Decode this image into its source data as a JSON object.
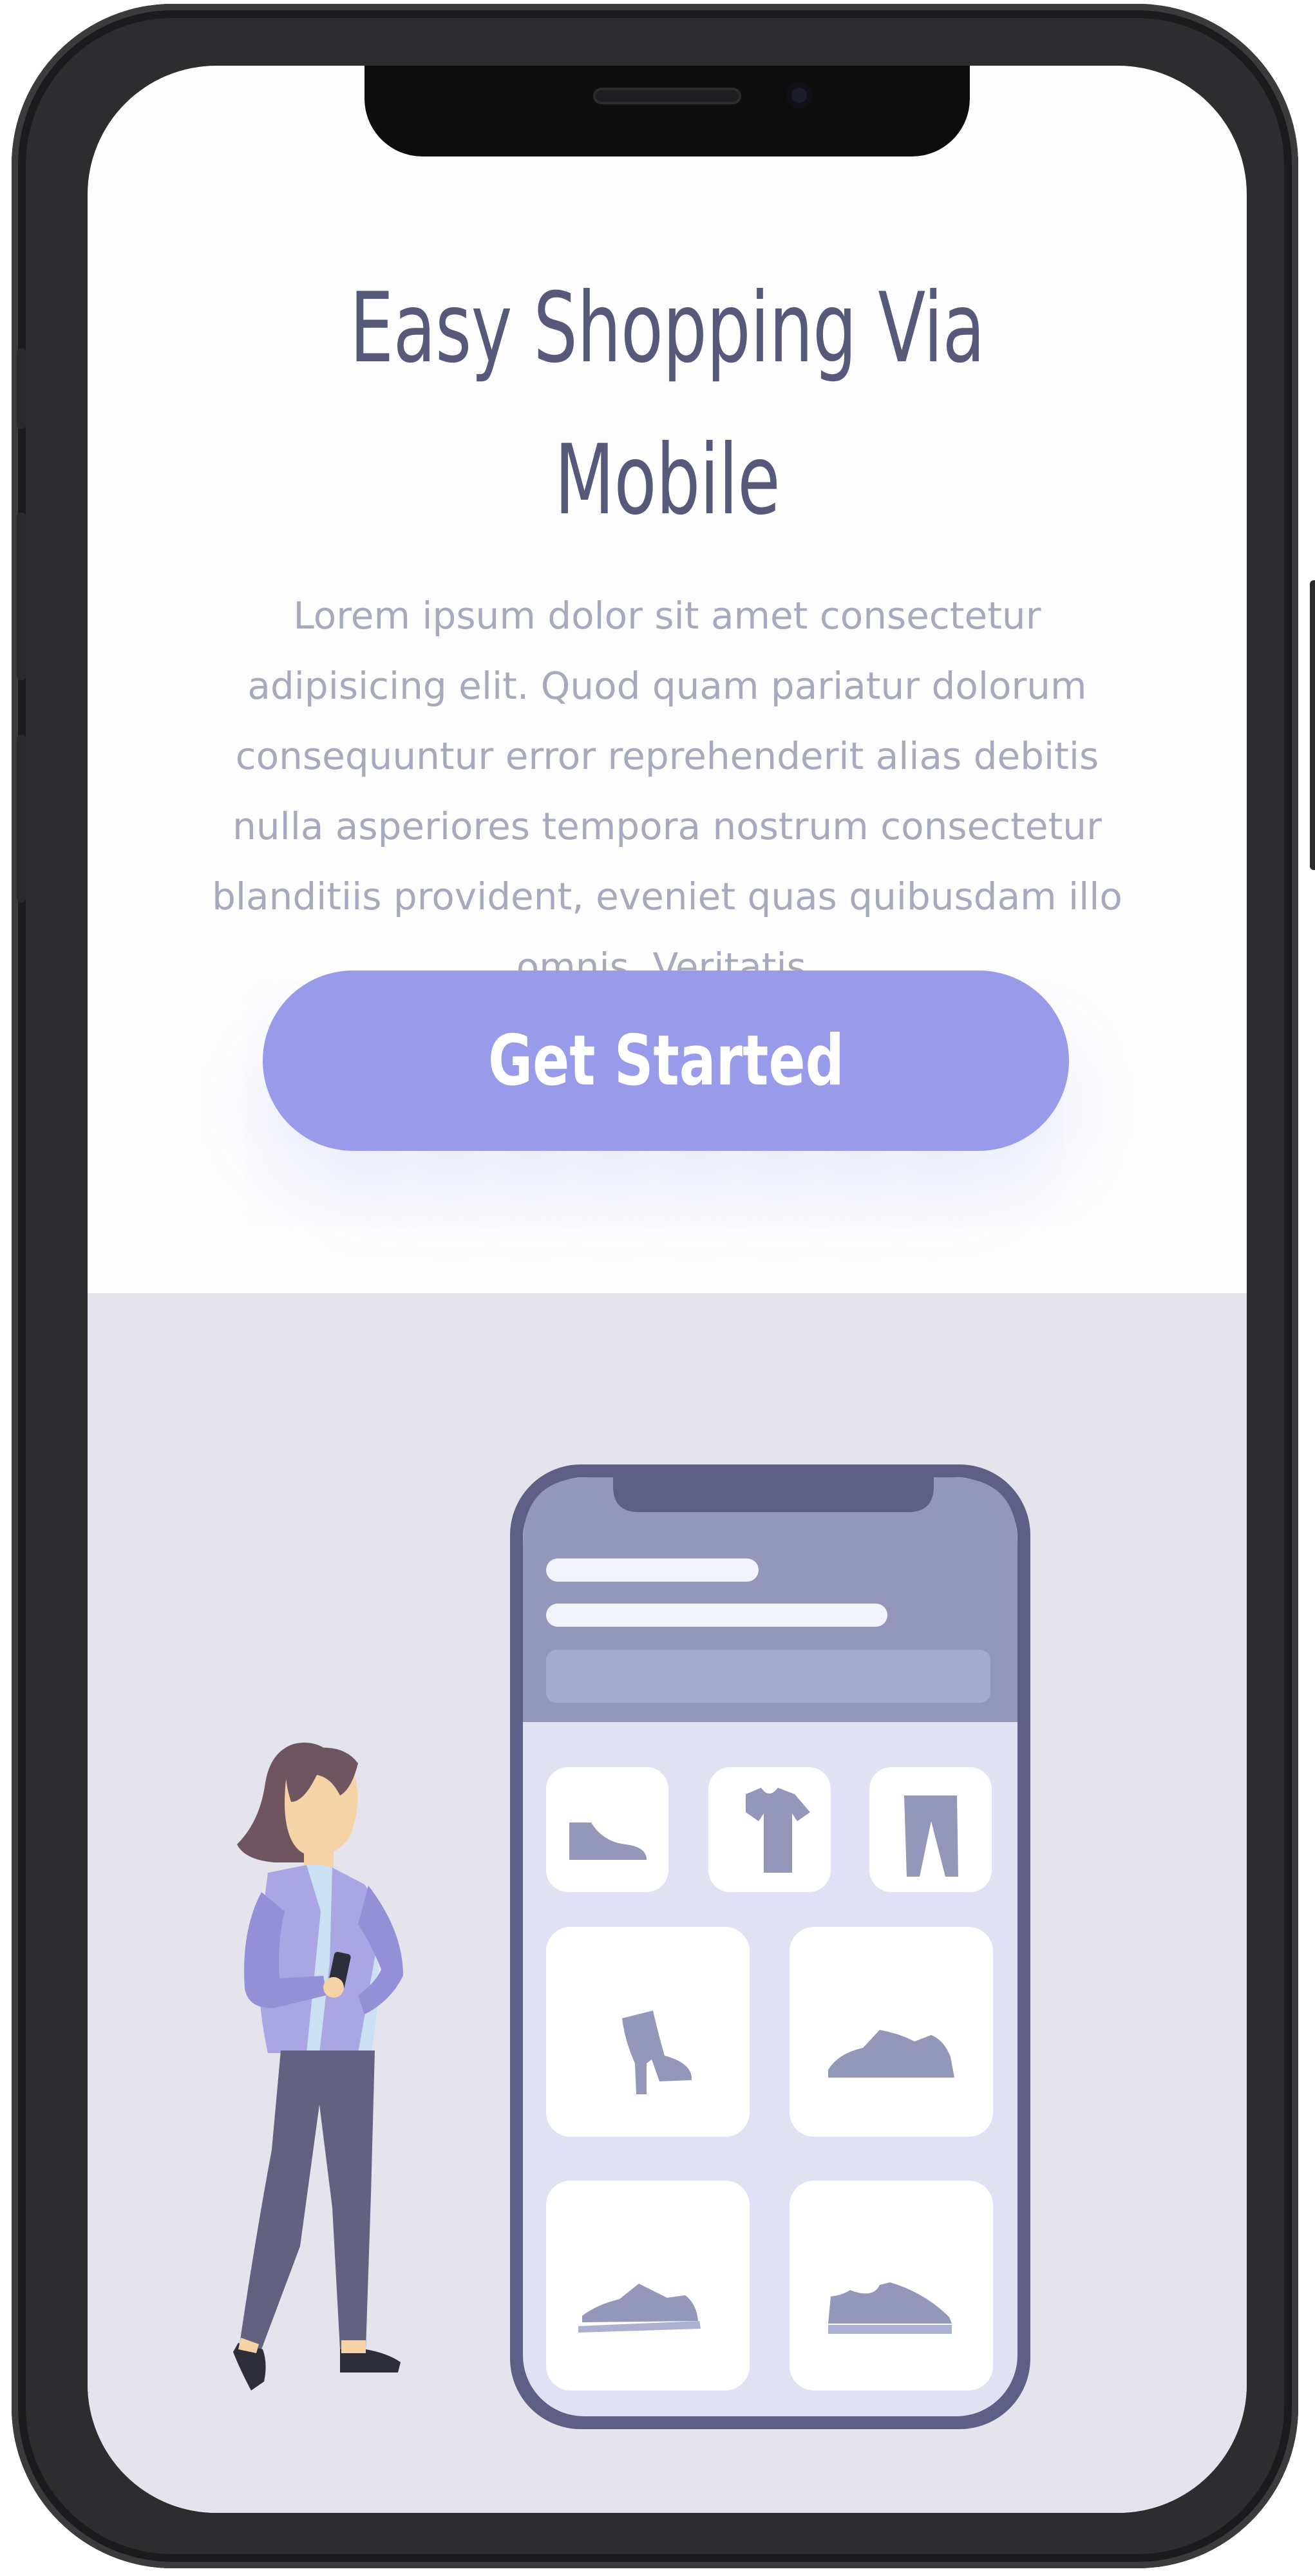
{
  "hero": {
    "title": "Easy Shopping Via Mobile",
    "description": "Lorem ipsum dolor sit amet consectetur adipisicing elit. Quod quam pariatur dolorum consequuntur error reprehenderit alias debitis nulla asperiores tempora nostrum consectetur blanditiis provident, eveniet quas quibusdam illo omnis. Veritatis.",
    "cta_label": "Get Started"
  },
  "illustration": {
    "product_icons": [
      "shoe-icon",
      "tshirt-icon",
      "pants-icon",
      "boot-icon",
      "sneaker-icon",
      "sneaker-icon",
      "sneaker-icon"
    ]
  },
  "colors": {
    "title": "#56597a",
    "body_text": "#a7a9bd",
    "accent": "#979bea",
    "illustration_bg": "#e5e4ec",
    "phone_outline": "#5e5f86"
  }
}
